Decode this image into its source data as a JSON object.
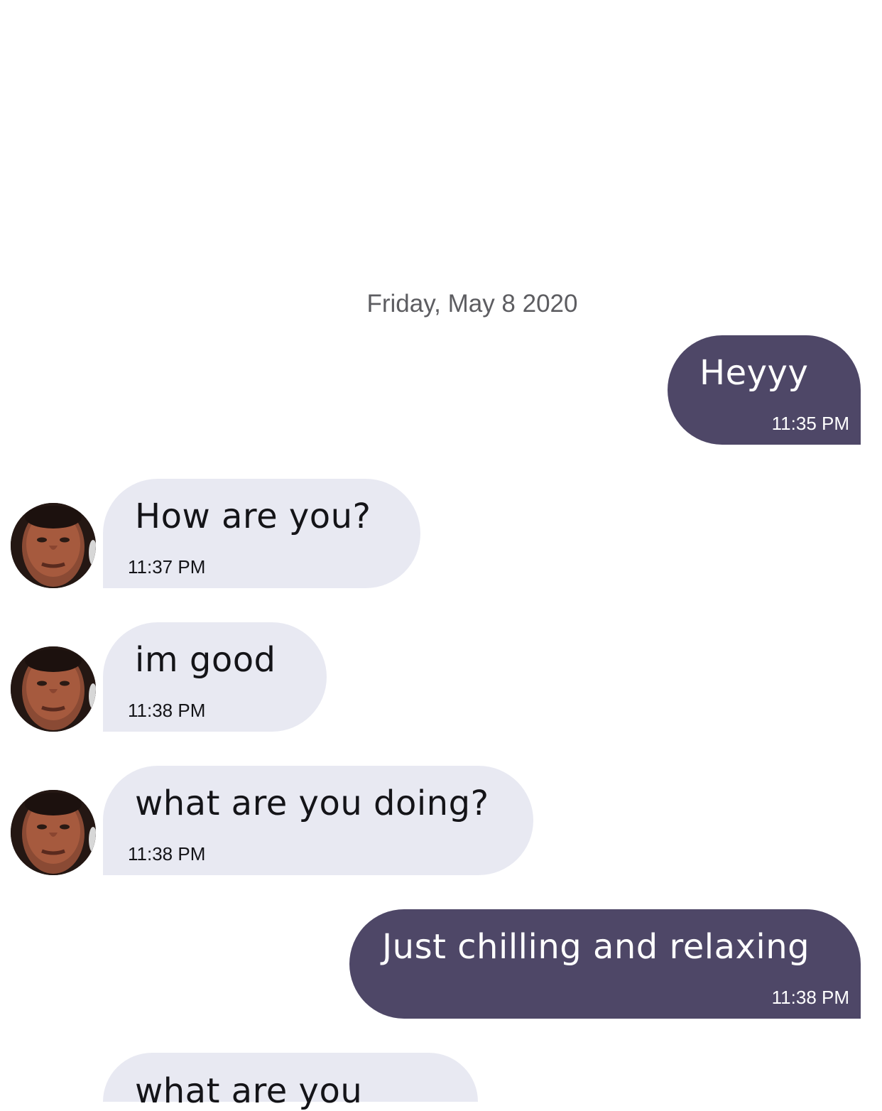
{
  "conversation": {
    "date_label": "Friday, May 8 2020",
    "messages": [
      {
        "id": "m1",
        "direction": "outgoing",
        "text": "Heyyy",
        "time": "11:35 PM"
      },
      {
        "id": "m2",
        "direction": "incoming",
        "text": "How are you?",
        "time": "11:37 PM",
        "avatar": "contact-avatar"
      },
      {
        "id": "m3",
        "direction": "incoming",
        "text": "im good",
        "time": "11:38 PM",
        "avatar": "contact-avatar"
      },
      {
        "id": "m4",
        "direction": "incoming",
        "text": "what are you doing?",
        "time": "11:38 PM",
        "avatar": "contact-avatar"
      },
      {
        "id": "m5",
        "direction": "outgoing",
        "text": "Just chilling and relaxing",
        "time": "11:38 PM"
      },
      {
        "id": "m6",
        "direction": "incoming",
        "text": "what are you",
        "time": ""
      }
    ]
  },
  "colors": {
    "outgoing_bubble": "#4e4767",
    "incoming_bubble": "#e8e9f2",
    "date_text": "#5d5d61",
    "background": "#ffffff"
  }
}
